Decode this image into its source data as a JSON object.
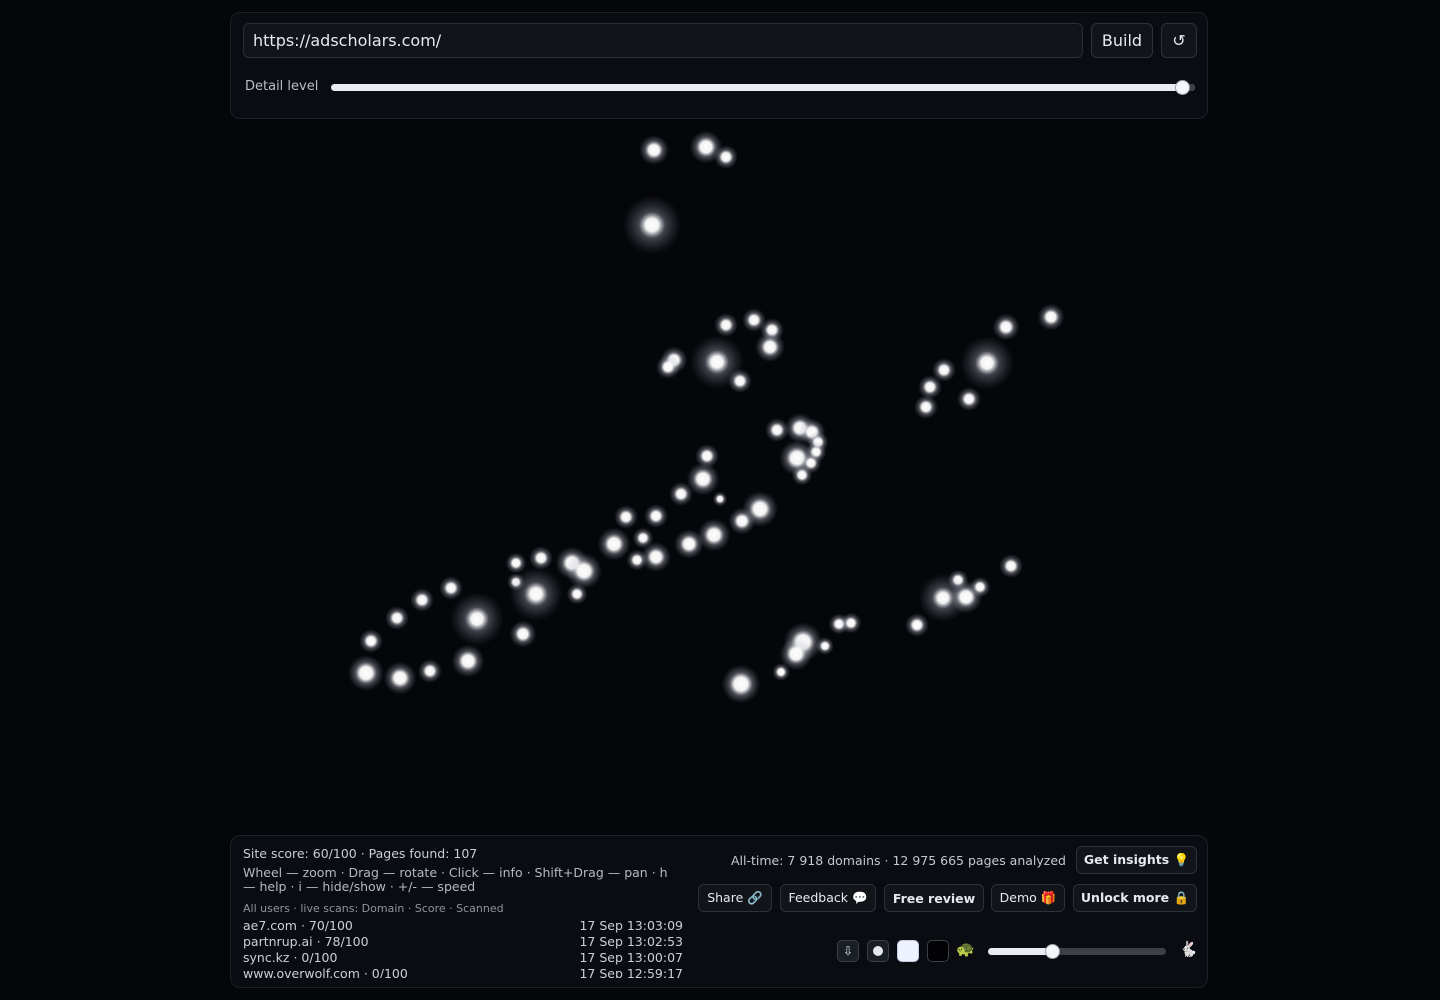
{
  "top": {
    "url_value": "https://adscholars.com/",
    "build_label": "Build",
    "refresh_icon": "↺",
    "detail_label": "Detail level",
    "detail_level_fraction": 0.985
  },
  "graph": {
    "glow_color": "#ffffff"
  },
  "bottom": {
    "stats": "Site score: 60/100 · Pages found: 107",
    "help": "Wheel — zoom · Drag — rotate · Click — info · Shift+Drag — pan · h — help · i — hide/show · +/- — speed",
    "scans_header": "All users · live scans: Domain · Score · Scanned",
    "scans": [
      {
        "domain": "ae7.com · 70/100",
        "time": "17 Sep 13:03:09"
      },
      {
        "domain": "partnrup.ai · 78/100",
        "time": "17 Sep 13:02:53"
      },
      {
        "domain": "sync.kz · 0/100",
        "time": "17 Sep 13:00:07"
      },
      {
        "domain": "www.overwolf.com · 0/100",
        "time": "17 Sep 12:59:17"
      }
    ],
    "alltime": "All-time: 7 918 domains · 12 975 665 pages analyzed",
    "insights_label": "Get insights 💡",
    "share_label": "Share 🔗",
    "feedback_label": "Feedback 💬",
    "review_label": "Free review",
    "demo_label": "Demo 🎁",
    "unlock_label": "Unlock more 🔒",
    "download_icon": "⇩",
    "turtle_icon": "🐢",
    "rabbit_icon": "🐇",
    "speed_fraction": 0.36
  }
}
